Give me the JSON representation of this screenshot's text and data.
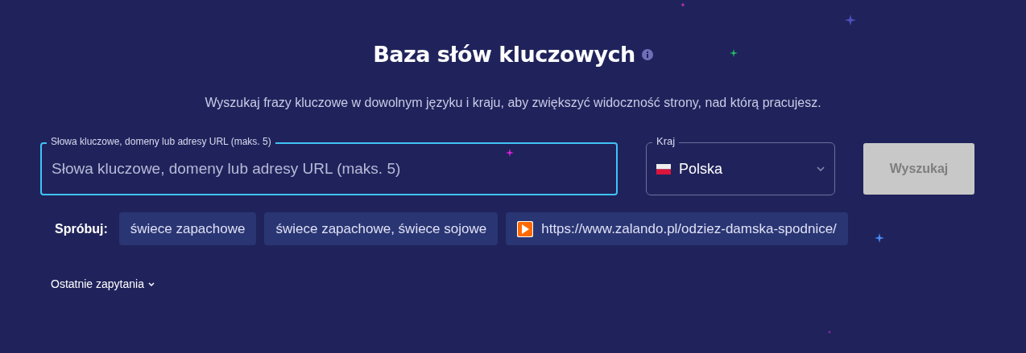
{
  "title": "Baza słów kluczowych",
  "subtitle": "Wyszukaj frazy kluczowe w dowolnym języku i kraju, aby zwiększyć widoczność strony, nad którą pracujesz.",
  "keyword_field": {
    "label": "Słowa kluczowe, domeny lub adresy URL (maks. 5)",
    "placeholder": "Słowa kluczowe, domeny lub adresy URL (maks. 5)",
    "focused": true
  },
  "country_select": {
    "label": "Kraj",
    "value": "Polska"
  },
  "search_button": {
    "label": "Wyszukaj",
    "disabled": true
  },
  "suggestions": {
    "label": "Spróbuj:",
    "items": [
      {
        "kind": "text",
        "text": "świece zapachowe"
      },
      {
        "kind": "text",
        "text": "świece zapachowe, świece sojowe"
      },
      {
        "kind": "url",
        "text": "https://www.zalando.pl/odziez-damska-spodnice/"
      }
    ]
  },
  "recent": {
    "label": "Ostatnie zapytania",
    "expanded": false
  }
}
